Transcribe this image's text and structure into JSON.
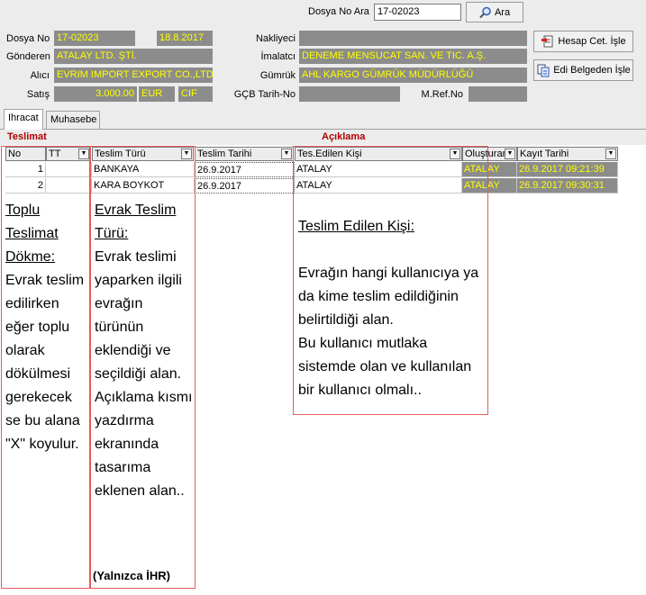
{
  "search": {
    "label": "Dosya No Ara",
    "value": "17-02023",
    "button": "Ara",
    "icon": "search-icon"
  },
  "header": {
    "dosya_no_label": "Dosya No",
    "dosya_no": "17-02023",
    "date": "18.8.2017",
    "gonderen_label": "Gönderen",
    "gonderen": "ATALAY LTD. ŞTİ.",
    "alici_label": "Alıcı",
    "alici": "EVRIM IMPORT EXPORT CO.,LTD.",
    "satis_label": "Satış",
    "satis_amount": "3.000.00",
    "satis_currency": "EUR",
    "satis_terms": "CIF",
    "nakliyeci_label": "Nakliyeci",
    "nakliyeci": "",
    "imalatci_label": "İmalatcı",
    "imalatci": "DENEME MENSUCAT SAN. VE TIC. A.Ş.",
    "gumruk_label": "Gümrük",
    "gumruk": "AHL KARGO GÜMRÜK MÜDÜRLÜĞÜ",
    "gcb_label": "GÇB Tarih-No",
    "gcb": "",
    "mref_label": "M.Ref.No",
    "mref": ""
  },
  "buttons": {
    "hesap": "Hesap Cet. İşle",
    "edi": "Edi Belgeden İşle"
  },
  "tabs": [
    {
      "label": "Ihracat",
      "active": true
    },
    {
      "label": "Muhasebe",
      "active": false
    }
  ],
  "band": {
    "teslimat": "Teslimat",
    "aciklama": "Açıklama"
  },
  "columns": [
    "No",
    "TT",
    "Teslim Türü",
    "Teslim Tarihi",
    "Tes.Edilen Kişi",
    "Oluşturan",
    "Kayıt Tarihi"
  ],
  "rows": [
    {
      "no": "1",
      "tt": "",
      "tur": "BANKAYA",
      "tarih": "26.9.2017",
      "kisi": "ATALAY",
      "olusturan": "ATALAY",
      "kayit": "26.9.2017 09:21:39"
    },
    {
      "no": "2",
      "tt": "",
      "tur": "KARA BOYKOT",
      "tarih": "26.9.2017",
      "kisi": "ATALAY",
      "olusturan": "ATALAY",
      "kayit": "26.9.2017 09:30:31"
    }
  ],
  "notes": {
    "left_title": "Toplu Teslimat Dökme:",
    "left_body": "Evrak teslim edilirken eğer toplu olarak dökülmesi gerekecek se bu alana \"X\" koyulur.",
    "mid_title": "Evrak Teslim Türü:",
    "mid_body": "Evrak teslimi yaparken ilgili evrağın türünün eklendiği ve seçildiği alan. Açıklama kısmı yazdırma ekranında tasarıma eklenen alan..",
    "mid_foot": "(Yalnızca İHR)",
    "right_title": "Teslim Edilen Kişi:",
    "right_body": "Evrağın hangi kullanıcıya ya da kime teslim edildiğinin belirtildiği alan.\nBu kullanıcı mutlaka sistemde olan ve kullanılan bir kullanıcı olmalı.."
  }
}
